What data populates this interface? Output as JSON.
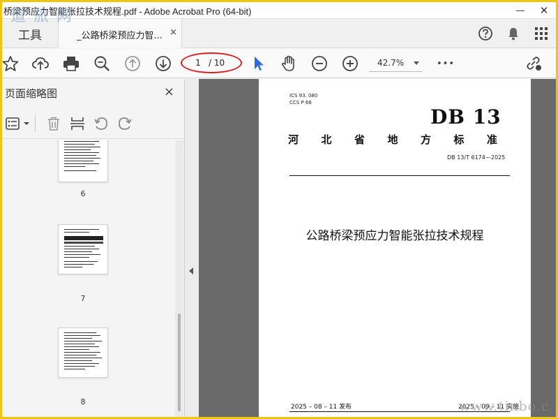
{
  "window": {
    "title": "桥梁预应力智能张拉技术规程.pdf - Adobe Acrobat Pro (64-bit)",
    "minimize": "—",
    "close": "✕"
  },
  "tabs": {
    "tools": "工具",
    "document": "_公路桥梁预应力智...",
    "close": "×"
  },
  "toolbar": {
    "current_page": "1",
    "total_pages": "/ 10",
    "zoom": "42.7%",
    "more": "•••"
  },
  "sidebar": {
    "title": "页面缩略图",
    "close": "×",
    "thumbnails": [
      {
        "page": "6"
      },
      {
        "page": "7"
      },
      {
        "page": "8"
      }
    ]
  },
  "document_page": {
    "ics": "ICS  93. 080",
    "ccs": "CCS  P  66",
    "db": "DB 13",
    "standard_chars": [
      "河",
      "北",
      "省",
      "地",
      "方",
      "标",
      "准"
    ],
    "code": "DB 13/T  6174—2025",
    "name": "公路桥梁预应力智能张拉技术规程",
    "published": "2025 – 08 – 11 发布",
    "implemented": "2025 – 09 – 11 实施"
  },
  "watermarks": {
    "top_left": "道 旅 网",
    "bottom_right": "www.tinbo.c"
  },
  "colors": {
    "accent_blue": "#2b6dd6",
    "annotation_red": "#d91f1f",
    "frame_yellow": "#f1c40f"
  }
}
